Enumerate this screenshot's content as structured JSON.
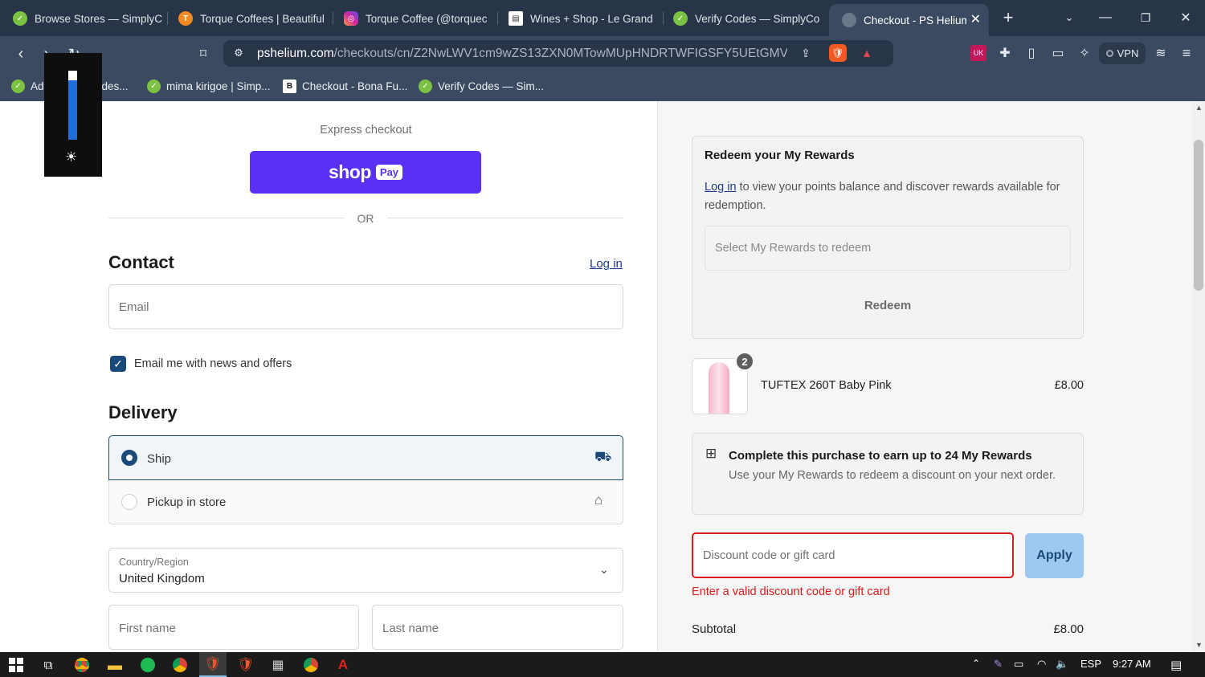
{
  "browser": {
    "tabs": [
      {
        "label": "Browse Stores — SimplyC",
        "favicon": "simplycodes-icon",
        "color": "#7cc242"
      },
      {
        "label": "Torque Coffees | Beautiful",
        "favicon": "torque-icon",
        "color": "#f08a24"
      },
      {
        "label": "Torque Coffee (@torquec",
        "favicon": "instagram-icon",
        "color": "#d6249f"
      },
      {
        "label": "Wines + Shop - Le Grand",
        "favicon": "page-icon",
        "color": "#ffffff"
      },
      {
        "label": "Verify Codes — SimplyCo",
        "favicon": "simplycodes-icon",
        "color": "#7cc242"
      },
      {
        "label": "Checkout - PS Helium",
        "favicon": "loading-icon",
        "color": "#6b778a"
      }
    ],
    "url_domain": "pshelium.com",
    "url_path": "/checkouts/cn/Z2NwLWV1cm9wZS13ZXN0MTowMUpHNDRTWFIGSFY5UEtGMVh...",
    "vpn_label": "VPN",
    "bookmarks": [
      {
        "label": "Add Promo Codes...",
        "favicon": "simplycodes-icon"
      },
      {
        "label": "mima kirigoe | Simp...",
        "favicon": "simplycodes-icon"
      },
      {
        "label": "Checkout - Bona Fu...",
        "favicon": "bonafide-icon"
      },
      {
        "label": "Verify Codes — Sim...",
        "favicon": "simplycodes-icon"
      }
    ]
  },
  "checkout": {
    "express_label": "Express checkout",
    "shop_text": "shop",
    "pay_text": "Pay",
    "or_label": "OR",
    "contact": {
      "title": "Contact",
      "login_link": "Log in",
      "email_placeholder": "Email",
      "newsletter_label": "Email me with news and offers",
      "newsletter_checked": true
    },
    "delivery": {
      "title": "Delivery",
      "options": [
        {
          "label": "Ship",
          "selected": true,
          "icon": "truck-icon"
        },
        {
          "label": "Pickup in store",
          "selected": false,
          "icon": "store-icon"
        }
      ],
      "country_label": "Country/Region",
      "country_value": "United Kingdom",
      "first_name_placeholder": "First name",
      "last_name_placeholder": "Last name"
    }
  },
  "summary": {
    "rewards": {
      "title": "Redeem your My Rewards",
      "login_link": "Log in",
      "description": "to view your points balance and discover rewards available for redemption.",
      "select_placeholder": "Select My Rewards to redeem",
      "redeem_button": "Redeem"
    },
    "item": {
      "name": "TUFTEX 260T Baby Pink",
      "price": "£8.00",
      "quantity": "2"
    },
    "earn": {
      "title": "Complete this purchase to earn up to 24 My Rewards",
      "description": "Use your My Rewards to redeem a discount on your next order."
    },
    "discount": {
      "placeholder": "Discount code or gift card",
      "apply_button": "Apply",
      "error": "Enter a valid discount code or gift card"
    },
    "subtotal_label": "Subtotal",
    "subtotal_value": "£8.00"
  },
  "taskbar": {
    "language": "ESP",
    "time": "9:27 AM"
  },
  "colors": {
    "shop_pay": "#5a31f4",
    "accent": "#1a4a7a",
    "error": "#d91c1c",
    "apply_bg": "#9ec8ef"
  }
}
